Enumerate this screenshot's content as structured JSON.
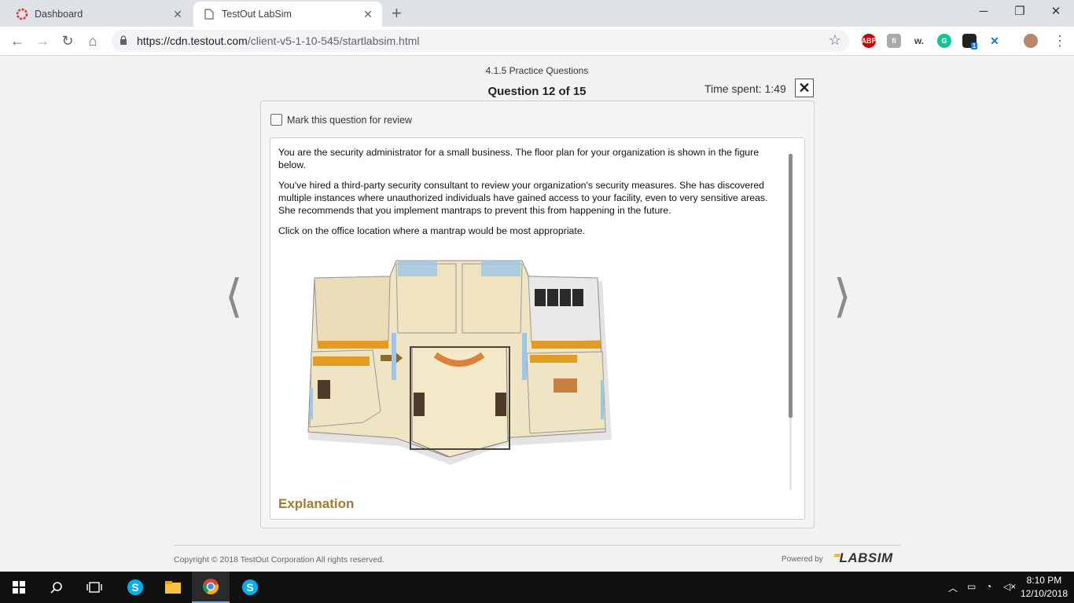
{
  "browser": {
    "tabs": [
      {
        "title": "Dashboard",
        "active": false,
        "icon": "testout-icon"
      },
      {
        "title": "TestOut LabSim",
        "active": true,
        "icon": "page-icon"
      }
    ],
    "url_host": "https://cdn.testout.com",
    "url_path": "/client-v5-1-10-545/startlabsim.html",
    "extensions": [
      "abp-icon",
      "fivefilters-icon",
      "w-icon",
      "grammarly-icon",
      "extension-badge-icon",
      "cancel-extension-icon",
      "profile-avatar"
    ],
    "extension_badge": "1"
  },
  "header": {
    "section": "4.1.5 Practice Questions",
    "question_counter": "Question 12 of 15",
    "time_spent": "Time spent: 1:49"
  },
  "question": {
    "review_label": "Mark this question for review",
    "paragraphs": [
      "You are the security administrator for a small business. The floor plan for your organization is shown in the figure below.",
      "You've hired a third-party security consultant to review your organization's security measures. She has discovered multiple instances where unauthorized individuals have gained access to your facility, even to very sensitive areas. She recommends that you implement mantraps to prevent this from happening in the future.",
      "Click on the office location where a mantrap would be most appropriate."
    ],
    "explanation_label": "Explanation"
  },
  "footer": {
    "copyright": "Copyright © 2018  TestOut Corporation All rights reserved.",
    "powered_by": "Powered by",
    "brand": "LABSIM"
  },
  "taskbar": {
    "time": "8:10 PM",
    "date": "12/10/2018"
  },
  "colors": {
    "accent_explanation": "#a07b32",
    "labsim_dash": "#f39a1f",
    "taskbar": "#101010"
  }
}
